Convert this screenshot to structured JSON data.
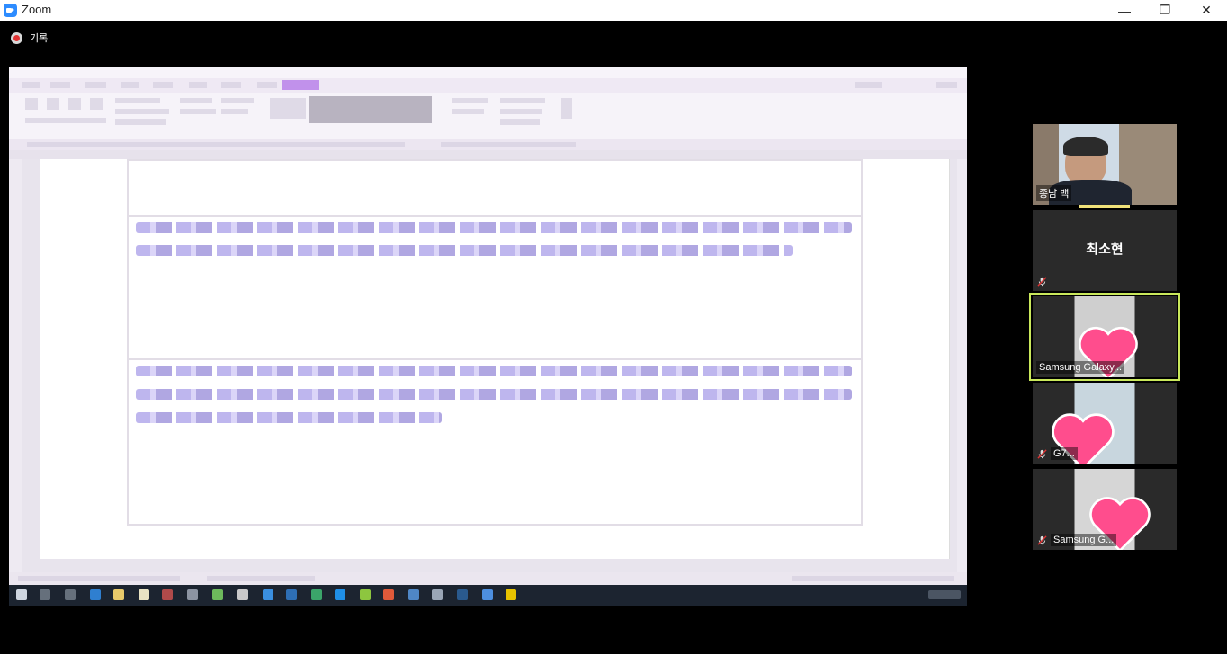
{
  "window": {
    "title": "Zoom",
    "minimize": "—",
    "restore": "❐",
    "close": "✕"
  },
  "recording": {
    "label": "기록",
    "icon": "record-icon"
  },
  "shared_screen": {
    "description_icon": "shared-document"
  },
  "participants": [
    {
      "name": "종남 백",
      "type": "video",
      "muted": false,
      "speaking": true
    },
    {
      "name": "최소현",
      "type": "name-only",
      "muted": true
    },
    {
      "name": "Samsung Galaxy...",
      "type": "video",
      "muted": false,
      "active": true,
      "reaction": "heart"
    },
    {
      "name": "G7...",
      "type": "video",
      "muted": true,
      "reaction": "heart"
    },
    {
      "name": "Samsung G...",
      "type": "video",
      "muted": true,
      "reaction": "heart"
    }
  ],
  "colors": {
    "accent_active": "#c9e85b",
    "heart": "#ff4d8d",
    "record": "#e03232"
  }
}
